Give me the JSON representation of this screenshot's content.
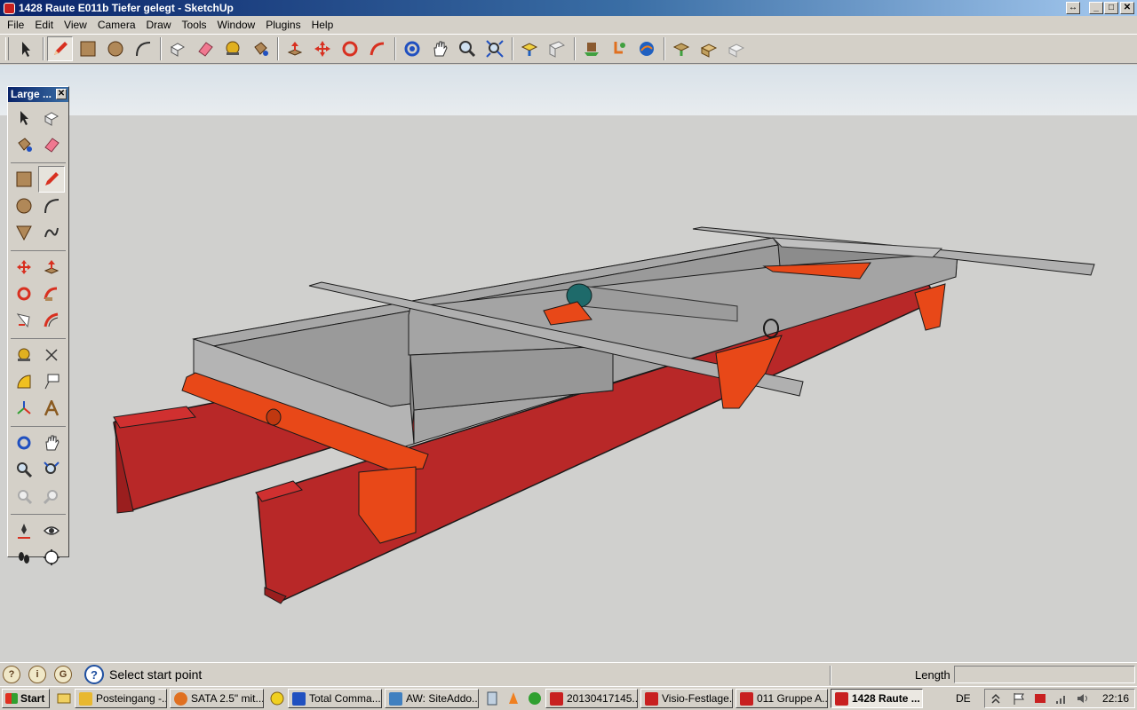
{
  "window": {
    "title": "1428 Raute E011b Tiefer gelegt - SketchUp",
    "restore_symbol": "↔",
    "min_symbol": "_",
    "max_symbol": "□",
    "close_symbol": "✕"
  },
  "menu": [
    "File",
    "Edit",
    "View",
    "Camera",
    "Draw",
    "Tools",
    "Window",
    "Plugins",
    "Help"
  ],
  "toolbar": {
    "tools": [
      "select-icon",
      "pencil-icon",
      "rectangle-icon",
      "circle-icon",
      "arc-icon",
      "make-component-icon",
      "eraser-icon",
      "tape-measure-icon",
      "paint-bucket-icon",
      "push-pull-icon",
      "move-icon",
      "rotate-icon",
      "follow-me-icon",
      "orbit-icon",
      "pan-icon",
      "zoom-icon",
      "zoom-extents-icon",
      "get-models-icon",
      "share-model-icon",
      "place-model-icon",
      "get-photo-texture-icon",
      "google-earth-icon",
      "components-icon",
      "sandbox-icon",
      "warehouse-icon"
    ],
    "active_tool": "pencil-icon"
  },
  "palette": {
    "title": "Large ...",
    "close_symbol": "✕",
    "active_tool": "pencil-icon"
  },
  "statusbar": {
    "text": "Select start point",
    "help_symbol": "?",
    "length_label": "Length",
    "length_value": ""
  },
  "taskbar": {
    "start_label": "Start",
    "tasks": [
      {
        "label": "Posteingang -...",
        "icon_color": "#e8b830"
      },
      {
        "label": "SATA 2.5\" mit...",
        "icon_color": "#e07020"
      },
      {
        "label": "Total Comma...",
        "icon_color": "#2050c0"
      },
      {
        "label": "AW: SiteAddo...",
        "icon_color": "#4080c0"
      },
      {
        "label": "20130417145...",
        "icon_color": "#c82020"
      },
      {
        "label": "Visio-Festlage...",
        "icon_color": "#c82020"
      },
      {
        "label": "011 Gruppe A...",
        "icon_color": "#c82020"
      },
      {
        "label": "1428 Raute ...",
        "icon_color": "#c82020",
        "active": true
      }
    ],
    "language": "DE",
    "clock": "22:16"
  }
}
